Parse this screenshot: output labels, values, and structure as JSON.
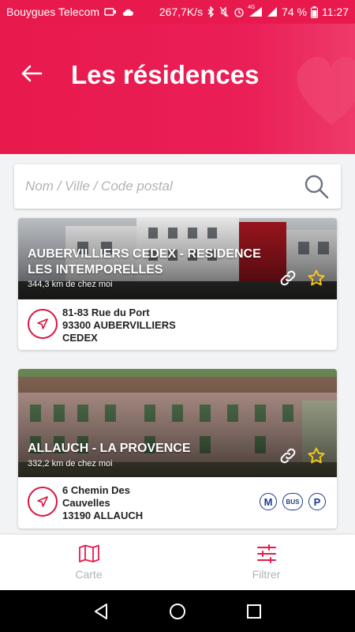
{
  "status_bar": {
    "carrier": "Bouygues Telecom",
    "speed": "267,7K/s",
    "network": "4G",
    "battery": "74 %",
    "time": "11:27"
  },
  "header": {
    "title": "Les résidences"
  },
  "search": {
    "placeholder": "Nom / Ville / Code postal"
  },
  "residences": [
    {
      "title": "AUBERVILLIERS CEDEX - RESIDENCE LES INTEMPORELLES",
      "distance": "344,3 km de chez moi",
      "address_lines": [
        "81-83 Rue du Port",
        "93300 AUBERVILLIERS",
        "CEDEX"
      ],
      "transport": []
    },
    {
      "title": "ALLAUCH - LA PROVENCE",
      "distance": "332,2 km de chez moi",
      "address_lines": [
        "6 Chemin Des",
        "Cauvelles",
        "13190 ALLAUCH"
      ],
      "transport": [
        "M",
        "BUS",
        "P"
      ]
    }
  ],
  "bottom_bar": {
    "items": [
      {
        "label": "Carte",
        "icon": "map-icon"
      },
      {
        "label": "Filtrer",
        "icon": "filter-sliders-icon"
      }
    ]
  },
  "colors": {
    "brand": "#e8194c",
    "accent_red": "#d9153f",
    "transport_blue": "#1e3a8a",
    "star_yellow": "#f5c518"
  }
}
